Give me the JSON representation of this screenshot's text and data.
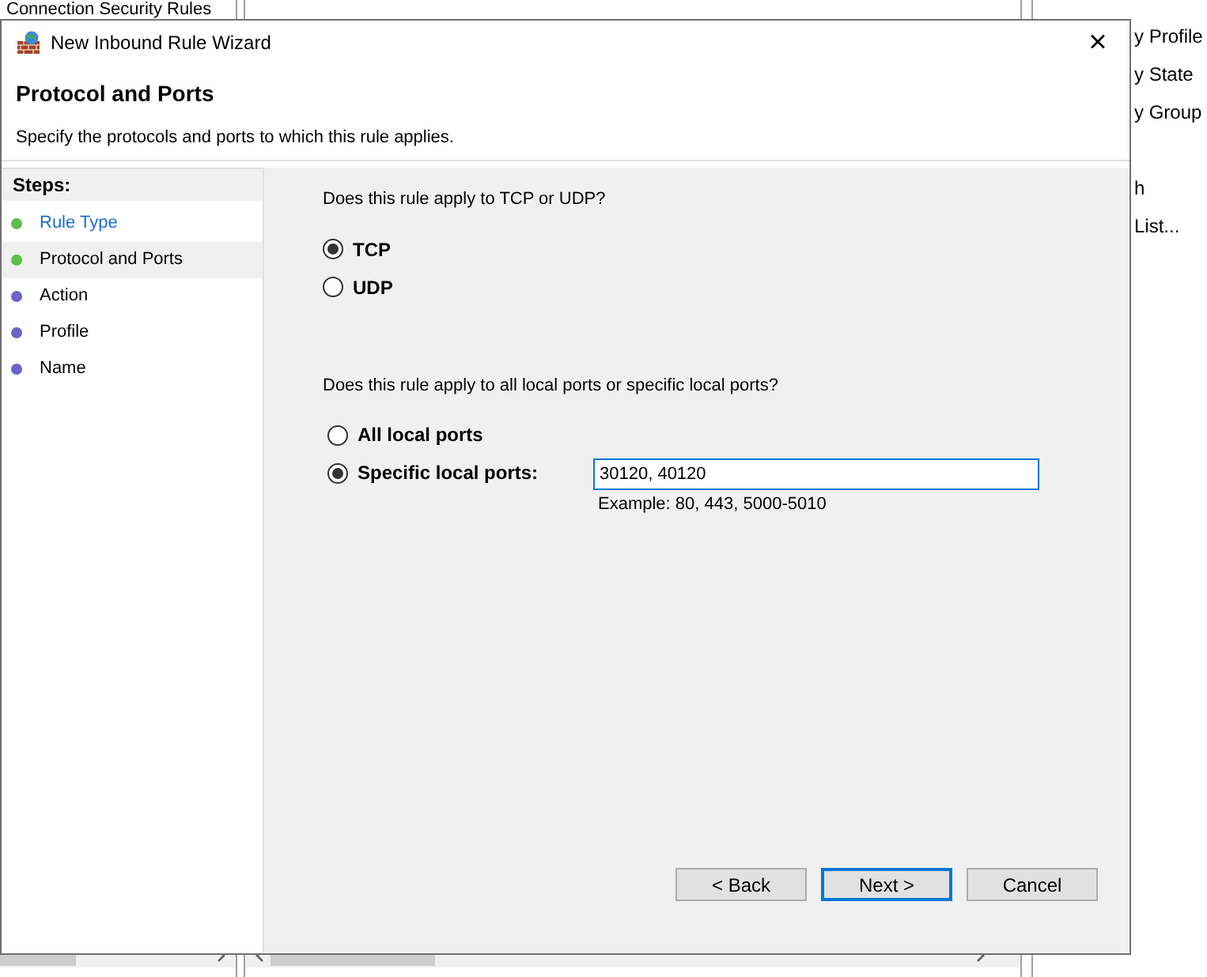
{
  "background": {
    "left_pane": {
      "items": [
        "Connection Security Rules"
      ]
    },
    "right_pane": {
      "items": [
        "y Profile",
        "y State",
        "y Group",
        "h",
        "List..."
      ]
    }
  },
  "window": {
    "title": "New Inbound Rule Wizard",
    "close": "×"
  },
  "header": {
    "title": "Protocol and Ports",
    "subtitle": "Specify the protocols and ports to which this rule applies."
  },
  "steps": {
    "heading": "Steps:",
    "items": [
      {
        "label": "Rule Type",
        "selected": false,
        "done": true
      },
      {
        "label": "Protocol and Ports",
        "selected": true,
        "done": true
      },
      {
        "label": "Action",
        "selected": false,
        "done": false
      },
      {
        "label": "Profile",
        "selected": false,
        "done": false
      },
      {
        "label": "Name",
        "selected": false,
        "done": false
      }
    ]
  },
  "protocol": {
    "question": "Does this rule apply to TCP or UDP?",
    "options": [
      {
        "label": "TCP",
        "selected": true
      },
      {
        "label": "UDP",
        "selected": false
      }
    ]
  },
  "ports": {
    "question": "Does this rule apply to all local ports or specific local ports?",
    "options": [
      {
        "label": "All local ports",
        "selected": false
      },
      {
        "label": "Specific local ports:",
        "selected": true
      }
    ],
    "value": "30120, 40120",
    "example": "Example: 80, 443, 5000-5010"
  },
  "buttons": [
    {
      "label": "< Back",
      "default": false
    },
    {
      "label": "Next >",
      "default": true
    },
    {
      "label": "Cancel",
      "default": false
    }
  ]
}
